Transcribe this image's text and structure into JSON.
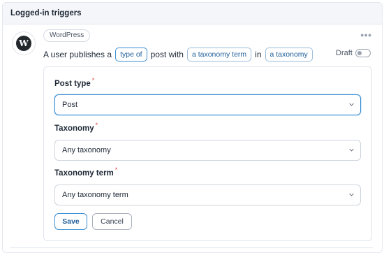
{
  "panel": {
    "title": "Logged-in triggers"
  },
  "trigger": {
    "integration": "WordPress",
    "logo_letter": "W",
    "sentence": {
      "part1": "A user publishes a",
      "token1": "type of",
      "part2": "post with",
      "token2": "a taxonomy term",
      "part3": "in",
      "token3": "a taxonomy"
    },
    "status_label": "Draft",
    "status_enabled": false,
    "more_icon": "more-horizontal-icon"
  },
  "form": {
    "fields": [
      {
        "label": "Post type",
        "required": "*",
        "value": "Post"
      },
      {
        "label": "Taxonomy",
        "required": "*",
        "value": "Any taxonomy"
      },
      {
        "label": "Taxonomy term",
        "required": "*",
        "value": "Any taxonomy term"
      }
    ],
    "save_label": "Save",
    "cancel_label": "Cancel"
  },
  "colors": {
    "accent": "#3a8fd4",
    "token_text": "#1f5f99",
    "required": "#e0443e",
    "header_bg": "#f4f6f9"
  }
}
